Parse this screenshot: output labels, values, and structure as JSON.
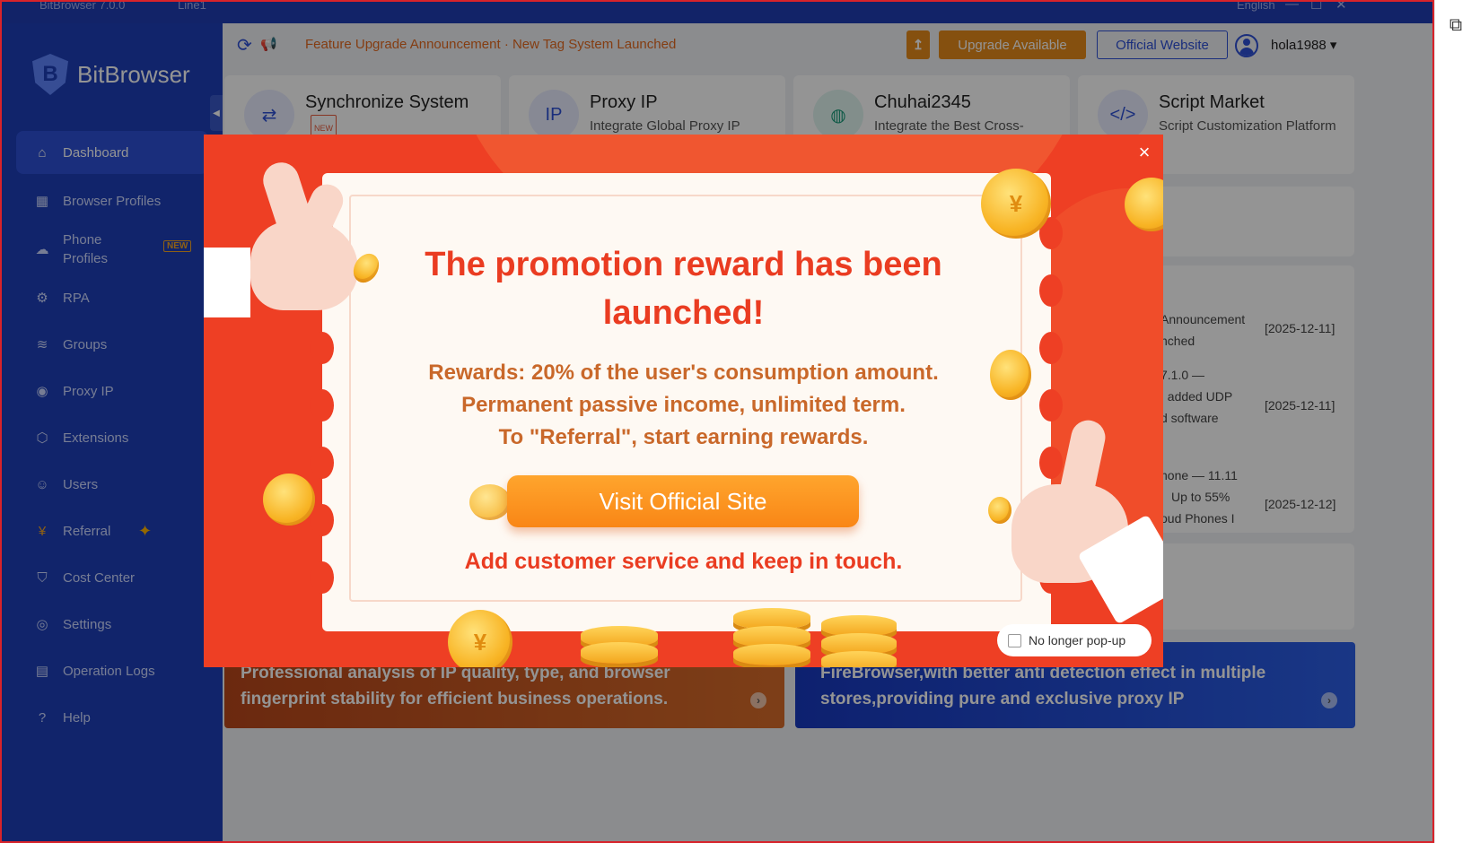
{
  "titlebar": {
    "app_version": "BitBrowser 7.0.0",
    "line": "Line1",
    "language": "English"
  },
  "brand": {
    "name": "BitBrowser"
  },
  "sidebar": {
    "items": [
      {
        "label": "Dashboard",
        "icon": "home-icon",
        "active": true
      },
      {
        "label": "Browser Profiles",
        "icon": "grid-icon"
      },
      {
        "label": "Phone Profiles",
        "icon": "cloud-phone-icon",
        "badge": "NEW"
      },
      {
        "label": "RPA",
        "icon": "robot-icon"
      },
      {
        "label": "Groups",
        "icon": "layers-icon"
      },
      {
        "label": "Proxy IP",
        "icon": "location-pin-icon"
      },
      {
        "label": "Extensions",
        "icon": "cube-icon"
      },
      {
        "label": "Users",
        "icon": "users-icon"
      },
      {
        "label": "Referral",
        "icon": "coin-icon"
      },
      {
        "label": "Cost Center",
        "icon": "shield-icon"
      },
      {
        "label": "Settings",
        "icon": "settings-icon"
      },
      {
        "label": "Operation Logs",
        "icon": "log-icon"
      },
      {
        "label": "Help",
        "icon": "help-icon"
      }
    ]
  },
  "header": {
    "announcement": "Feature Upgrade Announcement · New Tag System Launched",
    "upgrade_label": "Upgrade Available",
    "official_label": "Official Website",
    "username": "hola1988"
  },
  "cards": [
    {
      "title": "Synchronize System",
      "subtitle": "",
      "badge": "NEW"
    },
    {
      "title": "Proxy IP",
      "subtitle": "Integrate Global Proxy IP"
    },
    {
      "title": "Chuhai2345",
      "subtitle": "Integrate the Best Cross-"
    },
    {
      "title": "Script Market",
      "subtitle": "Script Customization Platform"
    }
  ],
  "news": [
    {
      "text1": "Announcement",
      "text2": "nched",
      "date": "[2025-12-11]"
    },
    {
      "text1": "7.1.0 —",
      "text2": ", added UDP",
      "text3": "d software",
      "date": "[2025-12-11]"
    },
    {
      "text1": "hone — 11.11",
      "text2": "Up to 55%",
      "text3": "oud Phones I",
      "date": "[2025-12-12]"
    }
  ],
  "banners": [
    {
      "text": "Professional analysis of IP quality, type, and browser fingerprint stability for efficient business operations.",
      "color": "#c4521f"
    },
    {
      "text": "FireBrowser,with better anti detection effect in multiple stores,providing pure and exclusive proxy IP",
      "color": "#1f44cc"
    }
  ],
  "modal": {
    "title_line1": "The promotion reward has been",
    "title_line2": "launched!",
    "line1": "Rewards: 20% of the user's consumption amount.",
    "line2": "Permanent passive income, unlimited term.",
    "line3": "To \"Referral\", start earning rewards.",
    "button": "Visit Official Site",
    "footer": "Add customer service and keep in touch.",
    "no_popup": "No longer pop-up",
    "close": "×"
  },
  "colors": {
    "sidebar": "#1e3fb8",
    "modal_bg": "#ee3f24",
    "accent_orange": "#e58b1b",
    "title_red": "#ea3c21"
  }
}
